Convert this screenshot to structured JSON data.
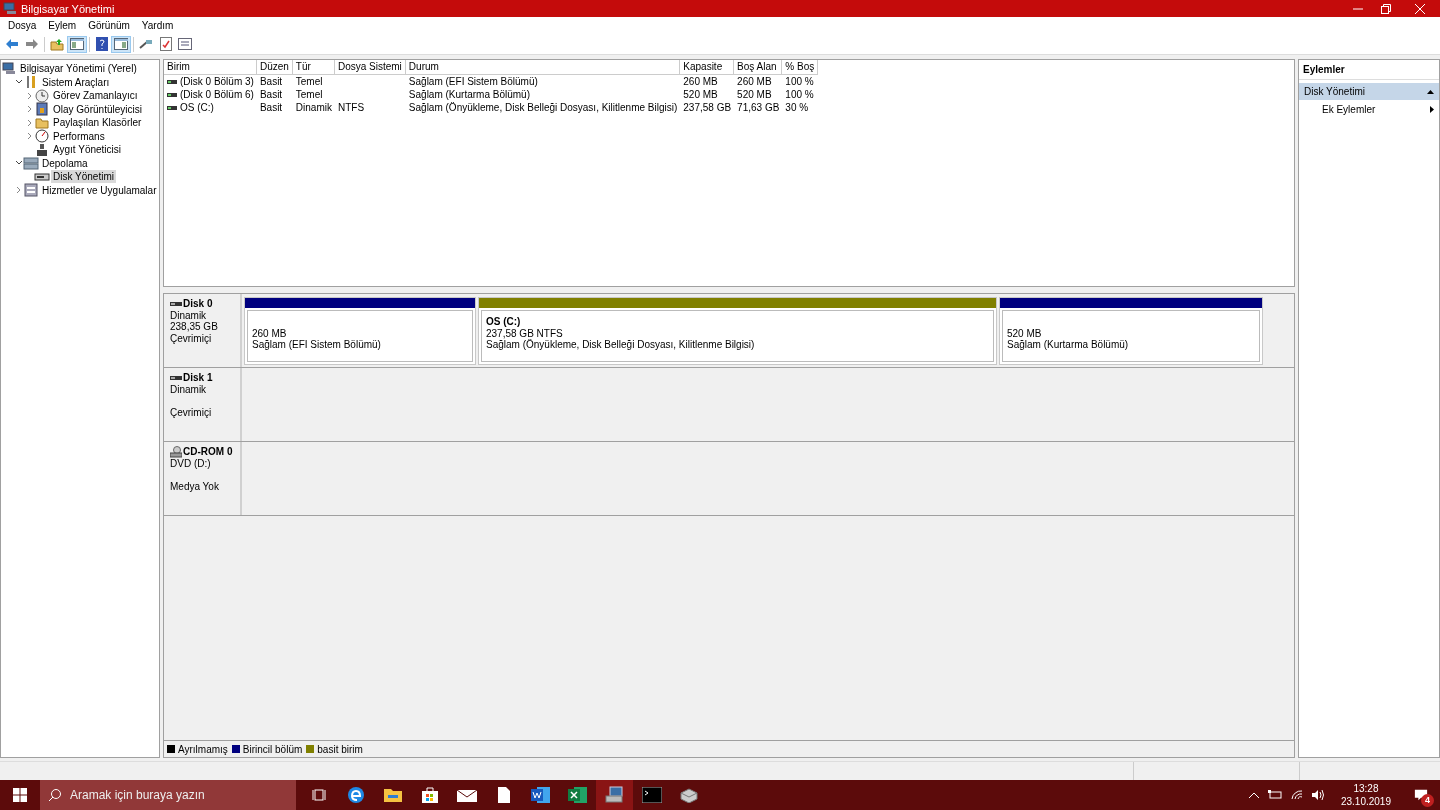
{
  "window": {
    "title": "Bilgisayar Yönetimi"
  },
  "menu": [
    "Dosya",
    "Eylem",
    "Görünüm",
    "Yardım"
  ],
  "toolbar": [
    {
      "kind": "back",
      "pressed": false
    },
    {
      "kind": "forward",
      "pressed": false
    },
    {
      "kind": "separator"
    },
    {
      "kind": "up",
      "pressed": false
    },
    {
      "kind": "tree",
      "pressed": true
    },
    {
      "kind": "separator"
    },
    {
      "kind": "help",
      "pressed": false
    },
    {
      "kind": "panel",
      "pressed": true
    },
    {
      "kind": "separator"
    },
    {
      "kind": "connect",
      "pressed": false
    },
    {
      "kind": "check",
      "pressed": false
    },
    {
      "kind": "list",
      "pressed": false
    }
  ],
  "tree": [
    {
      "label": "Bilgisayar Yönetimi (Yerel)",
      "kind": "computer",
      "selected": false,
      "children": [
        {
          "label": "Sistem Araçları",
          "kind": "tools",
          "expanded": true,
          "selected": false,
          "children": [
            {
              "label": "Görev Zamanlayıcı",
              "kind": "clock",
              "expanded": false,
              "selected": false
            },
            {
              "label": "Olay Görüntüleyicisi",
              "kind": "log",
              "expanded": false,
              "selected": false
            },
            {
              "label": "Paylaşılan Klasörler",
              "kind": "folder",
              "expanded": false,
              "selected": false
            },
            {
              "label": "Performans",
              "kind": "gauge",
              "expanded": false,
              "selected": false
            },
            {
              "label": "Aygıt Yöneticisi",
              "kind": "device",
              "selected": false
            }
          ]
        },
        {
          "label": "Depolama",
          "kind": "storage",
          "expanded": true,
          "selected": false,
          "children": [
            {
              "label": "Disk Yönetimi",
              "kind": "disk",
              "selected": true
            }
          ]
        },
        {
          "label": "Hizmetler ve Uygulamalar",
          "kind": "services",
          "expanded": false,
          "selected": false
        }
      ]
    }
  ],
  "table": {
    "columns": [
      "Birim",
      "Düzen",
      "Tür",
      "Dosya Sistemi",
      "Durum",
      "Kapasite",
      "Boş Alan",
      "% Boş"
    ],
    "rows": [
      {
        "cells": [
          "(Disk 0 Bölüm 3)",
          "Basit",
          "Temel",
          "",
          "Sağlam (EFI Sistem Bölümü)",
          "260 MB",
          "260 MB",
          "100 %"
        ]
      },
      {
        "cells": [
          "(Disk 0 Bölüm 6)",
          "Basit",
          "Temel",
          "",
          "Sağlam (Kurtarma Bölümü)",
          "520 MB",
          "520 MB",
          "100 %"
        ]
      },
      {
        "cells": [
          "OS (C:)",
          "Basit",
          "Dinamik",
          "NTFS",
          "Sağlam (Önyükleme, Disk Belleği Dosyası, Kilitlenme Bilgisi)",
          "237,58 GB",
          "71,63 GB",
          "30 %"
        ]
      }
    ]
  },
  "disks": [
    {
      "kind": "disk",
      "name": "Disk 0",
      "type": "Dinamik",
      "size": "238,35 GB",
      "status": "Çevrimiçi",
      "partitions": [
        {
          "kind": "primary",
          "size": "260 MB",
          "status": "Sağlam (EFI Sistem Bölümü)"
        },
        {
          "kind": "simple",
          "label": "OS  (C:)",
          "size": "237,58 GB NTFS",
          "status": "Sağlam (Önyükleme, Disk Belleği Dosyası, Kilitlenme Bilgisi)"
        },
        {
          "kind": "primary",
          "size": "520 MB",
          "status": "Sağlam (Kurtarma Bölümü)"
        }
      ]
    },
    {
      "kind": "disk",
      "name": "Disk 1",
      "type": "Dinamik",
      "status": "Çevrimiçi"
    },
    {
      "kind": "cdrom",
      "name": "CD-ROM 0",
      "type": "DVD (D:)",
      "status": "Medya Yok"
    }
  ],
  "legend": [
    {
      "label": "Ayrılmamış",
      "color": "#000000"
    },
    {
      "label": "Birincil bölüm",
      "color": "#00007f"
    },
    {
      "label": "basit birim",
      "color": "#808000"
    }
  ],
  "actions": {
    "title": "Eylemler",
    "sections": [
      {
        "label": "Disk Yönetimi",
        "expanded": true,
        "items": [
          "Ek Eylemler"
        ]
      }
    ]
  },
  "taskbar": {
    "search_placeholder": "Aramak için buraya yazın",
    "apps": [
      {
        "kind": "taskview",
        "selected": false
      },
      {
        "kind": "edge",
        "selected": false
      },
      {
        "kind": "explorer",
        "selected": false
      },
      {
        "kind": "store",
        "selected": false
      },
      {
        "kind": "mail",
        "selected": false
      },
      {
        "kind": "file",
        "selected": false
      },
      {
        "kind": "word",
        "selected": false
      },
      {
        "kind": "excel",
        "selected": false
      },
      {
        "kind": "compmgmt",
        "selected": true
      },
      {
        "kind": "terminal",
        "selected": false
      },
      {
        "kind": "drive",
        "selected": false
      }
    ],
    "time": "13:28",
    "date": "23.10.2019",
    "notifications": "4"
  }
}
